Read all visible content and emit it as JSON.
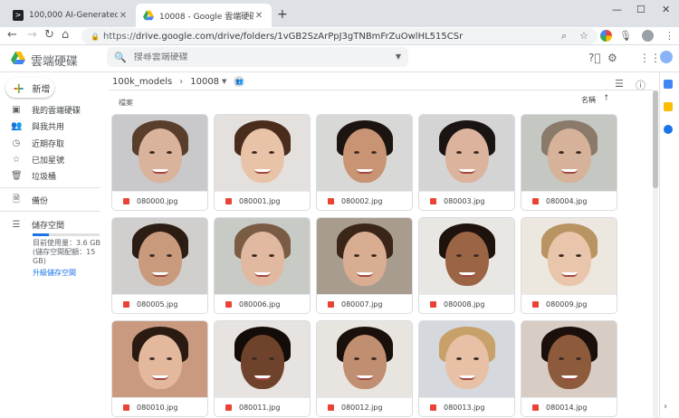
{
  "browser": {
    "tabs": [
      {
        "title": "100,000 AI-Generated Faces - ",
        "active": false
      },
      {
        "title": "10008 - Google 雲端硬碟",
        "active": true
      }
    ],
    "url_protocol": "https://",
    "url_rest": "drive.google.com/drive/folders/1vGB2SzArPpJ3gTNBmFrZuOwlHL515CSr"
  },
  "app": {
    "brand": "雲端硬碟",
    "search_placeholder": "搜尋雲端硬碟",
    "new_button": "新增"
  },
  "sidebar": {
    "items": [
      {
        "label": "我的雲端硬碟",
        "icon": "my-drive-icon"
      },
      {
        "label": "與我共用",
        "icon": "shared-with-me-icon"
      },
      {
        "label": "近期存取",
        "icon": "recent-icon"
      },
      {
        "label": "已加星號",
        "icon": "star-icon"
      },
      {
        "label": "垃圾桶",
        "icon": "trash-icon"
      }
    ],
    "backup": "備份",
    "storage": {
      "label": "儲存空間",
      "used_fraction": 0.24,
      "detail": "目前使用量：3.6 GB (儲存空間配額：15 GB)",
      "upgrade": "升級儲存空間"
    }
  },
  "main": {
    "breadcrumb_root": "100k_models",
    "breadcrumb_current": "10008",
    "section_label": "檔案",
    "sort_label": "名稱",
    "files": [
      {
        "name": "080000.jpg",
        "bg": "#c9c9cb",
        "skin": "#d9b39b",
        "hair": "#5a3e2c"
      },
      {
        "name": "080001.jpg",
        "bg": "#e3e0de",
        "skin": "#e8c3a8",
        "hair": "#4a2c1d"
      },
      {
        "name": "080002.jpg",
        "bg": "#d8d8d6",
        "skin": "#c89473",
        "hair": "#1c1410"
      },
      {
        "name": "080003.jpg",
        "bg": "#d4d4d4",
        "skin": "#dcb39c",
        "hair": "#1a1412"
      },
      {
        "name": "080004.jpg",
        "bg": "#c5c7c3",
        "skin": "#d7b29a",
        "hair": "#8a7a6a"
      },
      {
        "name": "080005.jpg",
        "bg": "#d0cfcd",
        "skin": "#c99a7c",
        "hair": "#2b1c14"
      },
      {
        "name": "080006.jpg",
        "bg": "#c8cbc5",
        "skin": "#e0b9a0",
        "hair": "#7a5c44"
      },
      {
        "name": "080007.jpg",
        "bg": "#a89c8e",
        "skin": "#d8ad92",
        "hair": "#3b2518"
      },
      {
        "name": "080008.jpg",
        "bg": "#e9e7e4",
        "skin": "#9b6545",
        "hair": "#1d120c"
      },
      {
        "name": "080009.jpg",
        "bg": "#ece7df",
        "skin": "#e9c5ac",
        "hair": "#b89463"
      },
      {
        "name": "080010.jpg",
        "bg": "#c99a80",
        "skin": "#e4b89c",
        "hair": "#2a1a12"
      },
      {
        "name": "080011.jpg",
        "bg": "#e6e3e0",
        "skin": "#6f432b",
        "hair": "#140c08"
      },
      {
        "name": "080012.jpg",
        "bg": "#e8e4df",
        "skin": "#c08e70",
        "hair": "#1a100b"
      },
      {
        "name": "080013.jpg",
        "bg": "#d5d8dc",
        "skin": "#e7c0a5",
        "hair": "#c7a06a"
      },
      {
        "name": "080014.jpg",
        "bg": "#d8cdc5",
        "skin": "#8d5a3c",
        "hair": "#1a0f0a"
      }
    ]
  },
  "colors": {
    "accent": "#1a73e8",
    "file_icon": "#ea4335"
  }
}
